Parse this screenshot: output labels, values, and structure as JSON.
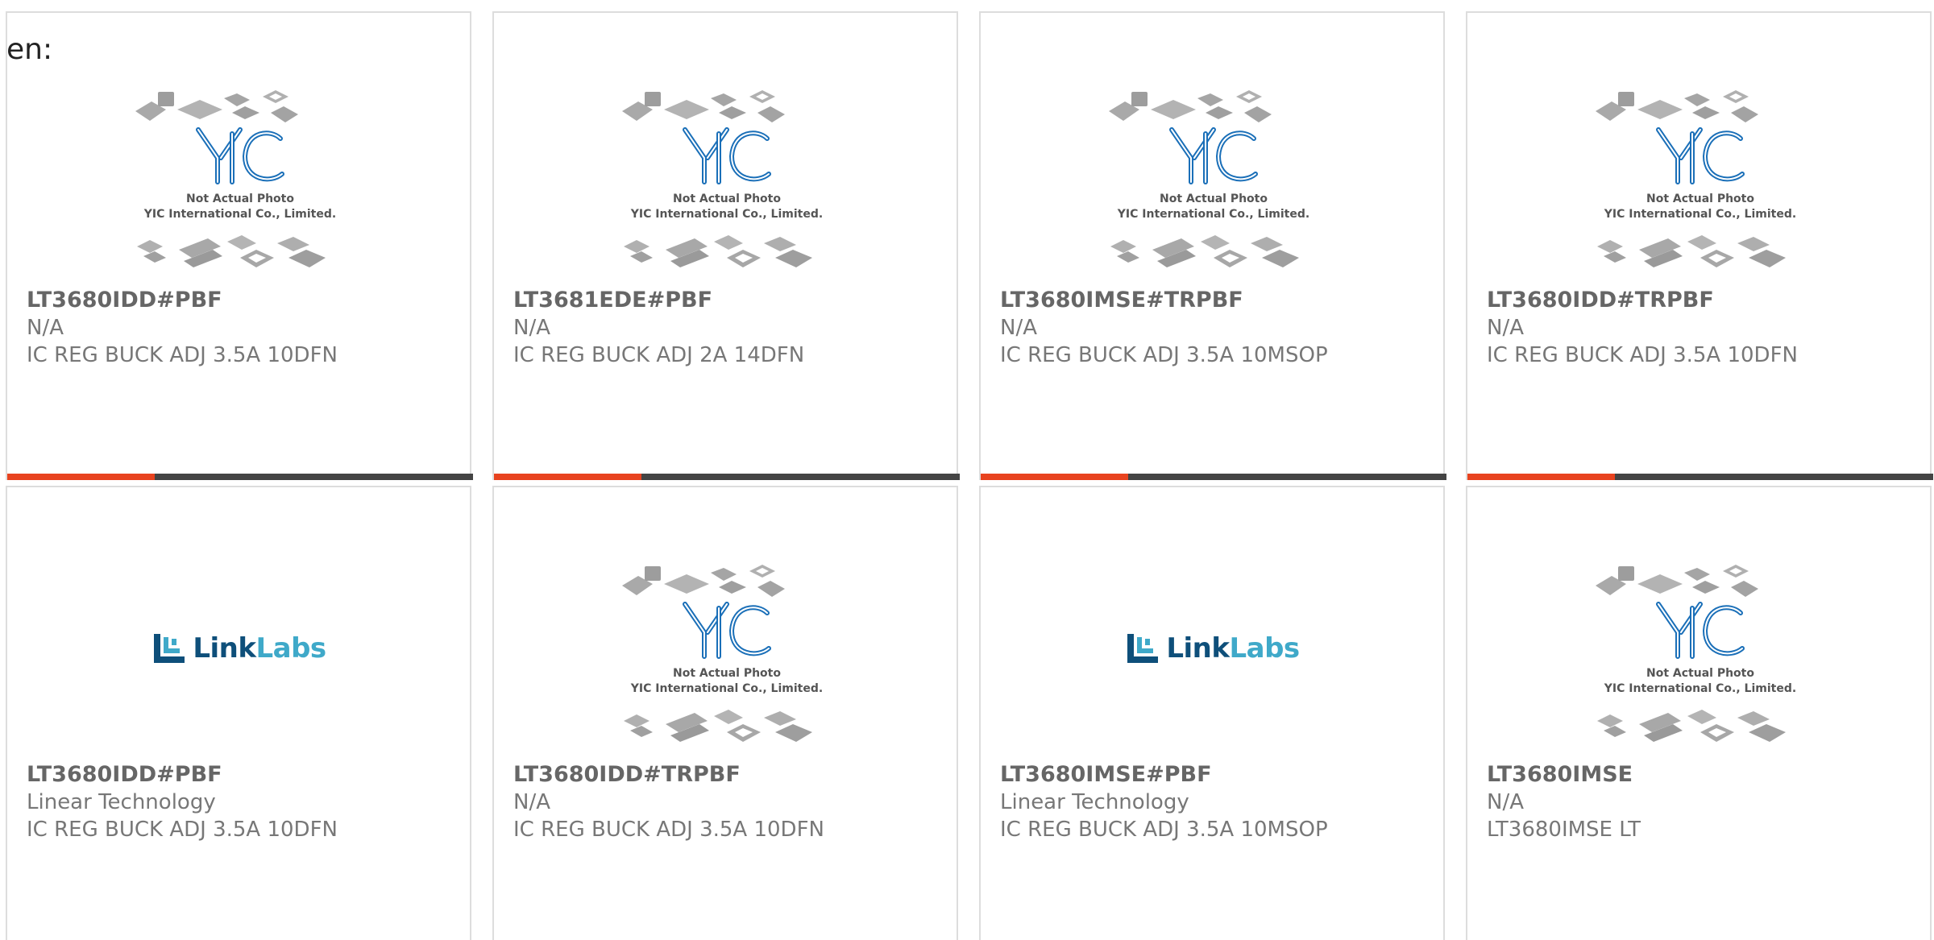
{
  "language_label": "en:",
  "colors": {
    "accent": "#e8431f",
    "bar_dark": "#444444",
    "yic_blue": "#1a6fb8",
    "linklabs_dark": "#0e4f7a",
    "linklabs_teal": "#3fa9c9"
  },
  "placeholder_yic": {
    "line1": "Not Actual Photo",
    "line2": "YIC International Co., Limited."
  },
  "placeholder_linklabs": {
    "brand": "LinkLabs"
  },
  "products": [
    {
      "part": "LT3680IDD#PBF",
      "manufacturer": "N/A",
      "description": "IC REG BUCK ADJ 3.5A 10DFN",
      "image": "yic-placeholder"
    },
    {
      "part": "LT3681EDE#PBF",
      "manufacturer": "N/A",
      "description": "IC REG BUCK ADJ 2A 14DFN",
      "image": "yic-placeholder"
    },
    {
      "part": "LT3680IMSE#TRPBF",
      "manufacturer": "N/A",
      "description": "IC REG BUCK ADJ 3.5A 10MSOP",
      "image": "yic-placeholder"
    },
    {
      "part": "LT3680IDD#TRPBF",
      "manufacturer": "N/A",
      "description": "IC REG BUCK ADJ 3.5A 10DFN",
      "image": "yic-placeholder"
    },
    {
      "part": "LT3680IDD#PBF",
      "manufacturer": "Linear Technology",
      "description": "IC REG BUCK ADJ 3.5A 10DFN",
      "image": "linklabs-logo"
    },
    {
      "part": "LT3680IDD#TRPBF",
      "manufacturer": "N/A",
      "description": "IC REG BUCK ADJ 3.5A 10DFN",
      "image": "yic-placeholder"
    },
    {
      "part": "LT3680IMSE#PBF",
      "manufacturer": "Linear Technology",
      "description": "IC REG BUCK ADJ 3.5A 10MSOP",
      "image": "linklabs-logo"
    },
    {
      "part": "LT3680IMSE",
      "manufacturer": "N/A",
      "description": "LT3680IMSE LT",
      "image": "yic-placeholder"
    }
  ]
}
